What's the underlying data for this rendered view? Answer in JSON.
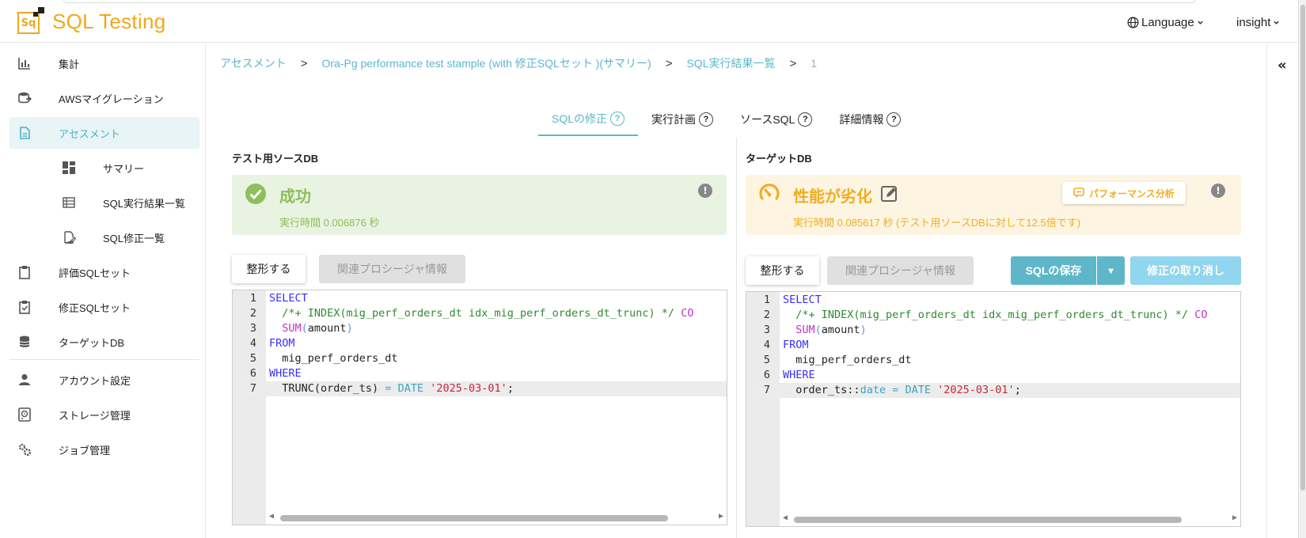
{
  "app": {
    "title": "SQL Testing",
    "logo_text": "Sq",
    "language_label": "Language",
    "user_label": "insight"
  },
  "sidebar": {
    "items": [
      {
        "label": "集計",
        "icon": "bar-chart-icon"
      },
      {
        "label": "AWSマイグレーション",
        "icon": "database-migrate-icon"
      },
      {
        "label": "アセスメント",
        "icon": "document-icon"
      },
      {
        "label": "サマリー",
        "icon": "dashboard-icon"
      },
      {
        "label": "SQL実行結果一覧",
        "icon": "list-icon"
      },
      {
        "label": "SQL修正一覧",
        "icon": "edit-document-icon"
      },
      {
        "label": "評価SQLセット",
        "icon": "clipboard-icon"
      },
      {
        "label": "修正SQLセット",
        "icon": "clipboard-check-icon"
      },
      {
        "label": "ターゲットDB",
        "icon": "database-icon"
      },
      {
        "label": "アカウント設定",
        "icon": "person-icon"
      },
      {
        "label": "ストレージ管理",
        "icon": "storage-icon"
      },
      {
        "label": "ジョブ管理",
        "icon": "gears-icon"
      }
    ]
  },
  "breadcrumb": {
    "items": [
      "アセスメント",
      "Ora-Pg performance test stample (with 修正SQLセット )(サマリー)",
      "SQL実行結果一覧"
    ],
    "current": "1",
    "separator": ">"
  },
  "collapse_label": "«",
  "tabs": [
    {
      "label": "SQLの修正",
      "help": "?"
    },
    {
      "label": "実行計画",
      "help": "?"
    },
    {
      "label": "ソースSQL",
      "help": "?"
    },
    {
      "label": "詳細情報",
      "help": "?"
    }
  ],
  "source": {
    "title": "テスト用ソースDB",
    "status": "成功",
    "exec_time": "実行時間 0.006876 秒",
    "info": "!",
    "format_button": "整形する",
    "proc_button": "関連プロシージャ情報",
    "line_numbers": [
      "1",
      "2",
      "3",
      "4",
      "5",
      "6",
      "7"
    ],
    "code": {
      "l1": "SELECT",
      "l2_comment": "/*+ INDEX(mig_perf_orders_dt idx_mig_perf_orders_dt_trunc) */",
      "l2_tail": "CO",
      "l3_fn": "SUM",
      "l3_open": "(",
      "l3_arg": "amount",
      "l3_close": ")",
      "l4": "FROM",
      "l5": "mig_perf_orders_dt",
      "l6": "WHERE",
      "l7_a": "TRUNC",
      "l7_b": "(order_ts)",
      "l7_eq": "=",
      "l7_date": "DATE",
      "l7_str": "'2025-03-01'",
      "l7_end": ";"
    }
  },
  "target": {
    "title": "ターゲットDB",
    "status": "性能が劣化",
    "exec_time": "実行時間 0.085617 秒 (テスト用ソースDBに対して12.5倍です)",
    "info": "!",
    "perf_button": "パフォーマンス分析",
    "format_button": "整形する",
    "proc_button": "関連プロシージャ情報",
    "save_button": "SQLの保存",
    "save_dropdown": "▾",
    "revert_button": "修正の取り消し",
    "line_numbers": [
      "1",
      "2",
      "3",
      "4",
      "5",
      "6",
      "7"
    ],
    "code": {
      "l1": "SELECT",
      "l2_comment": "/*+ INDEX(mig_perf_orders_dt idx_mig_perf_orders_dt_trunc) */",
      "l2_tail": "CO",
      "l3_fn": "SUM",
      "l3_open": "(",
      "l3_arg": "amount",
      "l3_close": ")",
      "l4": "FROM",
      "l5": "mig_perf_orders_dt",
      "l6": "WHERE",
      "l7_a": "order_ts",
      "l7_cast": "::",
      "l7_type": "date",
      "l7_eq": "=",
      "l7_date": "DATE",
      "l7_str": "'2025-03-01'",
      "l7_end": ";"
    }
  },
  "colors": {
    "accent": "#5db7c8",
    "brand": "#f1a81b",
    "success": "#8cc05a",
    "warning": "#f0ad22"
  }
}
